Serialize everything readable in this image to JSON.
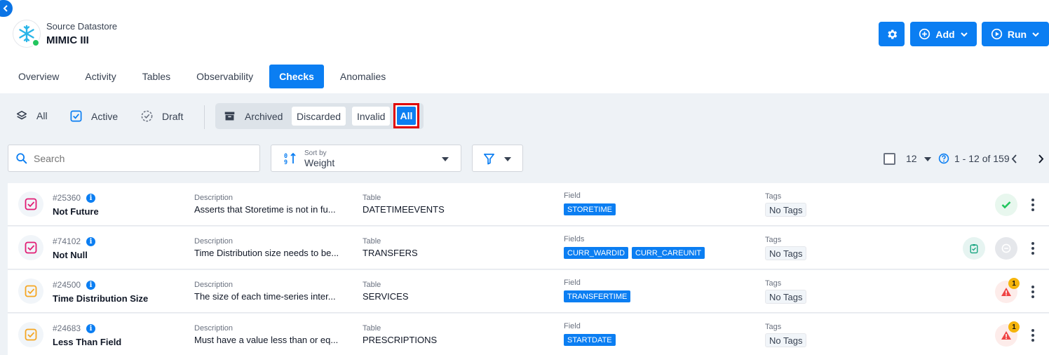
{
  "header": {
    "subtitle": "Source Datastore",
    "title": "MIMIC III",
    "add_label": "Add",
    "run_label": "Run"
  },
  "tabs": [
    "Overview",
    "Activity",
    "Tables",
    "Observability",
    "Checks",
    "Anomalies"
  ],
  "active_tab": "Checks",
  "check_filters": {
    "all": "All",
    "active": "Active",
    "draft": "Draft"
  },
  "status_filters": {
    "archived": "Archived",
    "discarded": "Discarded",
    "invalid": "Invalid",
    "all": "All"
  },
  "search": {
    "placeholder": "Search"
  },
  "sort": {
    "caption": "Sort by",
    "value": "Weight"
  },
  "pagination": {
    "page_size": "12",
    "range": "1 - 12 of 159"
  },
  "rows": [
    {
      "id": "#25360",
      "name": "Not Future",
      "description_label": "Description",
      "description": "Asserts that Storetime is not in fu...",
      "table_label": "Table",
      "table": "DATETIMEEVENTS",
      "field_label": "Field",
      "fields": [
        "STORETIME"
      ],
      "tags_label": "Tags",
      "tags": "No Tags",
      "status": "passed"
    },
    {
      "id": "#74102",
      "name": "Not Null",
      "description_label": "Description",
      "description": "Time Distribution size needs to be...",
      "table_label": "Table",
      "table": "TRANSFERS",
      "field_label": "Fields",
      "fields": [
        "CURR_WARDID",
        "CURR_CAREUNIT"
      ],
      "tags_label": "Tags",
      "tags": "No Tags",
      "status": "pending"
    },
    {
      "id": "#24500",
      "name": "Time Distribution Size",
      "description_label": "Description",
      "description": "The size of each time-series inter...",
      "table_label": "Table",
      "table": "SERVICES",
      "field_label": "Field",
      "fields": [
        "TRANSFERTIME"
      ],
      "tags_label": "Tags",
      "tags": "No Tags",
      "status": "anomaly",
      "anomaly_count": "1"
    },
    {
      "id": "#24683",
      "name": "Less Than Field",
      "description_label": "Description",
      "description": "Must have a value less than or eq...",
      "table_label": "Table",
      "table": "PRESCRIPTIONS",
      "field_label": "Field",
      "fields": [
        "STARTDATE"
      ],
      "tags_label": "Tags",
      "tags": "No Tags",
      "status": "anomaly",
      "anomaly_count": "1"
    }
  ],
  "colors": {
    "primary": "#0b7ef2",
    "highlight": "#e00000",
    "success": "#22c55e",
    "warning": "#f5b40b",
    "danger": "#ef4444"
  }
}
